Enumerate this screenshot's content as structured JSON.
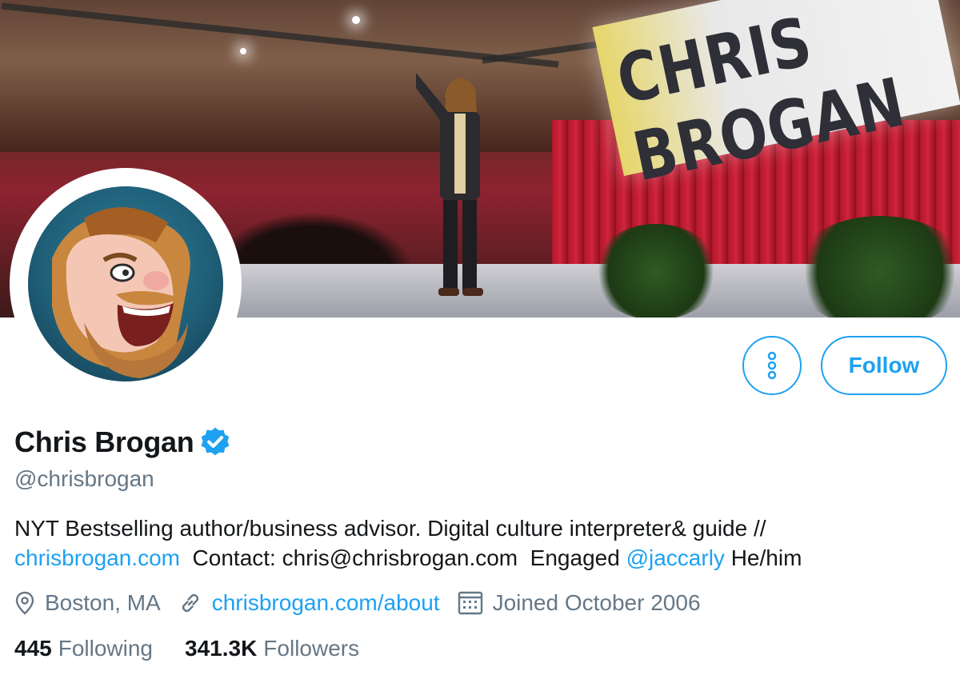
{
  "banner": {
    "sign_text": "CHRIS BROGAN"
  },
  "actions": {
    "follow_label": "Follow"
  },
  "profile": {
    "name": "Chris Brogan",
    "handle": "@chrisbrogan",
    "bio": {
      "line1": "NYT Bestselling author/business advisor. Digital culture interpreter& guide //",
      "link1": "chrisbrogan.com",
      "middle": "  Contact: chris@chrisbrogan.com  Engaged ",
      "mention": "@jaccarly",
      "end": " He/him"
    },
    "location": "Boston, MA",
    "website": "chrisbrogan.com/about",
    "joined": "Joined October 2006",
    "following_count": "445",
    "following_label": "Following",
    "followers_count": "341.3K",
    "followers_label": "Followers"
  },
  "colors": {
    "accent": "#1da1f2",
    "text": "#14171a",
    "muted": "#657786"
  },
  "icons": {
    "more": "more-vertical-icon",
    "verified": "verified-badge-icon",
    "location": "location-pin-icon",
    "link": "link-icon",
    "calendar": "calendar-icon"
  }
}
